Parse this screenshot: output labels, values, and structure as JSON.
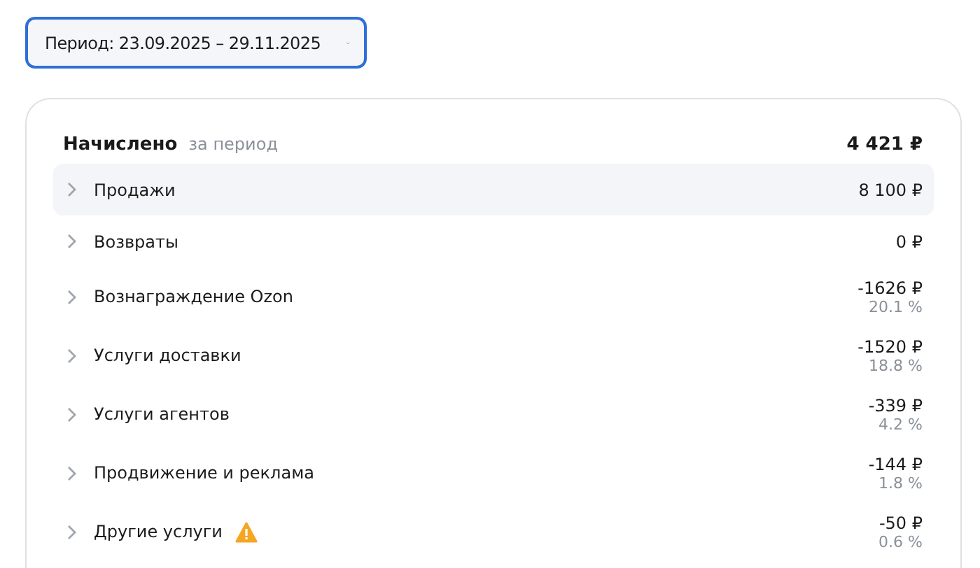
{
  "period_select": {
    "label": "Период: 23.09.2025 – 29.11.2025"
  },
  "summary": {
    "title": "Начислено",
    "subtitle": "за период",
    "total": "4 421 ₽"
  },
  "rows": [
    {
      "label": "Продажи",
      "amount": "8 100 ₽",
      "highlighted": true,
      "warning": false
    },
    {
      "label": "Возвраты",
      "amount": "0 ₽",
      "highlighted": false,
      "warning": false
    },
    {
      "label": "Вознаграждение Ozon",
      "amount": "-1626 ₽",
      "share": "20.1 %",
      "highlighted": false,
      "warning": false
    },
    {
      "label": "Услуги доставки",
      "amount": "-1520 ₽",
      "share": "18.8 %",
      "highlighted": false,
      "warning": false
    },
    {
      "label": "Услуги агентов",
      "amount": "-339 ₽",
      "share": "4.2 %",
      "highlighted": false,
      "warning": false
    },
    {
      "label": "Продвижение и реклама",
      "amount": "-144 ₽",
      "share": "1.8 %",
      "highlighted": false,
      "warning": false
    },
    {
      "label": "Другие услуги",
      "amount": "-50 ₽",
      "share": "0.6 %",
      "highlighted": false,
      "warning": true
    }
  ]
}
